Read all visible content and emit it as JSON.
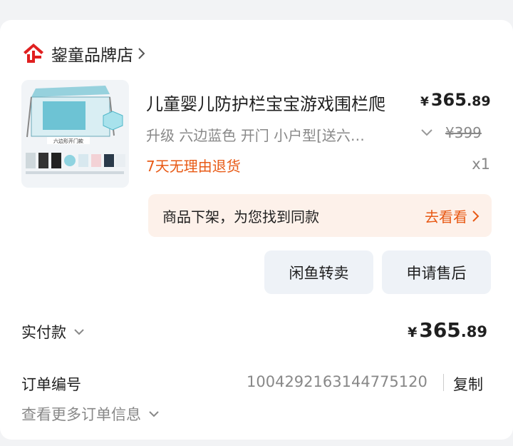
{
  "shop": {
    "name": "鋆童品牌店",
    "logo": "store-logo-icon"
  },
  "product": {
    "title": "儿童婴儿防护栏宝宝游戏围栏爬",
    "price_currency": "¥",
    "price_int": "365",
    "price_dec": ".89",
    "spec": "升级 六边蓝色 开门 小户型[送六…",
    "original_price": "¥399",
    "return_policy": "7天无理由退货",
    "quantity": "x1",
    "image_caption": "六边形开门款"
  },
  "off_shelf": {
    "message": "商品下架，为您找到同款",
    "link": "去看看"
  },
  "actions": {
    "resell": "闲鱼转卖",
    "after_sale": "申请售后"
  },
  "payment": {
    "label": "实付款",
    "currency": "¥",
    "amount_int": "365",
    "amount_dec": ".89"
  },
  "order": {
    "label": "订单编号",
    "number": "1004292163144775120",
    "copy": "复制",
    "more": "查看更多订单信息"
  },
  "colors": {
    "accent": "#e85a16",
    "muted": "#888888",
    "offshelf_bg": "#fdf1ea",
    "button_bg": "#eef2f7"
  }
}
